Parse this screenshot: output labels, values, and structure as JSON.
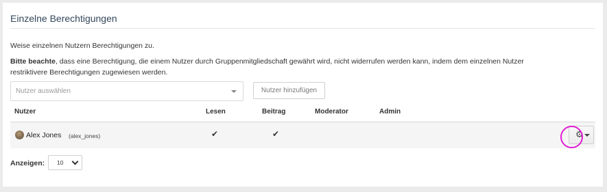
{
  "panel": {
    "title": "Einzelne Berechtigungen",
    "intro": "Weise einzelnen Nutzern Berechtigungen zu.",
    "note_strong": "Bitte beachte",
    "note_text": ", dass eine Berechtigung, die einem Nutzer durch Gruppenmitgliedschaft gewährt wird, nicht widerrufen werden kann, indem dem einzelnen Nutzer restriktivere Berechtigungen zugewiesen werden."
  },
  "user_select": {
    "placeholder": "Nutzer auswählen"
  },
  "add_button_label": "Nutzer hinzufügen",
  "table": {
    "columns": [
      "Nutzer",
      "Lesen",
      "Beitrag",
      "Moderator",
      "Admin"
    ],
    "rows": [
      {
        "name": "Alex Jones",
        "handle": "(alex_jones)",
        "read": "✔",
        "post": "✔",
        "moderator": "",
        "admin": ""
      }
    ]
  },
  "pagination": {
    "label": "Anzeigen:",
    "page_size": "10"
  },
  "colors": {
    "highlight": "#e01bd1",
    "title": "#33475b"
  }
}
